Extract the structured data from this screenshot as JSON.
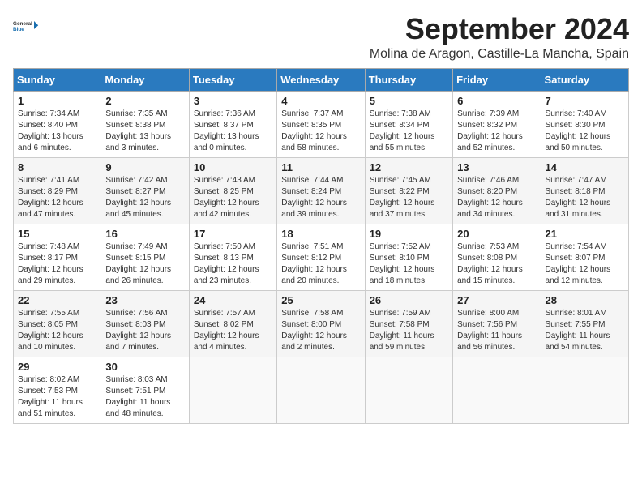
{
  "logo": {
    "text_general": "General",
    "text_blue": "Blue"
  },
  "title": "September 2024",
  "subtitle": "Molina de Aragon, Castille-La Mancha, Spain",
  "days_of_week": [
    "Sunday",
    "Monday",
    "Tuesday",
    "Wednesday",
    "Thursday",
    "Friday",
    "Saturday"
  ],
  "weeks": [
    [
      {
        "day": "1",
        "info": "Sunrise: 7:34 AM\nSunset: 8:40 PM\nDaylight: 13 hours\nand 6 minutes."
      },
      {
        "day": "2",
        "info": "Sunrise: 7:35 AM\nSunset: 8:38 PM\nDaylight: 13 hours\nand 3 minutes."
      },
      {
        "day": "3",
        "info": "Sunrise: 7:36 AM\nSunset: 8:37 PM\nDaylight: 13 hours\nand 0 minutes."
      },
      {
        "day": "4",
        "info": "Sunrise: 7:37 AM\nSunset: 8:35 PM\nDaylight: 12 hours\nand 58 minutes."
      },
      {
        "day": "5",
        "info": "Sunrise: 7:38 AM\nSunset: 8:34 PM\nDaylight: 12 hours\nand 55 minutes."
      },
      {
        "day": "6",
        "info": "Sunrise: 7:39 AM\nSunset: 8:32 PM\nDaylight: 12 hours\nand 52 minutes."
      },
      {
        "day": "7",
        "info": "Sunrise: 7:40 AM\nSunset: 8:30 PM\nDaylight: 12 hours\nand 50 minutes."
      }
    ],
    [
      {
        "day": "8",
        "info": "Sunrise: 7:41 AM\nSunset: 8:29 PM\nDaylight: 12 hours\nand 47 minutes."
      },
      {
        "day": "9",
        "info": "Sunrise: 7:42 AM\nSunset: 8:27 PM\nDaylight: 12 hours\nand 45 minutes."
      },
      {
        "day": "10",
        "info": "Sunrise: 7:43 AM\nSunset: 8:25 PM\nDaylight: 12 hours\nand 42 minutes."
      },
      {
        "day": "11",
        "info": "Sunrise: 7:44 AM\nSunset: 8:24 PM\nDaylight: 12 hours\nand 39 minutes."
      },
      {
        "day": "12",
        "info": "Sunrise: 7:45 AM\nSunset: 8:22 PM\nDaylight: 12 hours\nand 37 minutes."
      },
      {
        "day": "13",
        "info": "Sunrise: 7:46 AM\nSunset: 8:20 PM\nDaylight: 12 hours\nand 34 minutes."
      },
      {
        "day": "14",
        "info": "Sunrise: 7:47 AM\nSunset: 8:18 PM\nDaylight: 12 hours\nand 31 minutes."
      }
    ],
    [
      {
        "day": "15",
        "info": "Sunrise: 7:48 AM\nSunset: 8:17 PM\nDaylight: 12 hours\nand 29 minutes."
      },
      {
        "day": "16",
        "info": "Sunrise: 7:49 AM\nSunset: 8:15 PM\nDaylight: 12 hours\nand 26 minutes."
      },
      {
        "day": "17",
        "info": "Sunrise: 7:50 AM\nSunset: 8:13 PM\nDaylight: 12 hours\nand 23 minutes."
      },
      {
        "day": "18",
        "info": "Sunrise: 7:51 AM\nSunset: 8:12 PM\nDaylight: 12 hours\nand 20 minutes."
      },
      {
        "day": "19",
        "info": "Sunrise: 7:52 AM\nSunset: 8:10 PM\nDaylight: 12 hours\nand 18 minutes."
      },
      {
        "day": "20",
        "info": "Sunrise: 7:53 AM\nSunset: 8:08 PM\nDaylight: 12 hours\nand 15 minutes."
      },
      {
        "day": "21",
        "info": "Sunrise: 7:54 AM\nSunset: 8:07 PM\nDaylight: 12 hours\nand 12 minutes."
      }
    ],
    [
      {
        "day": "22",
        "info": "Sunrise: 7:55 AM\nSunset: 8:05 PM\nDaylight: 12 hours\nand 10 minutes."
      },
      {
        "day": "23",
        "info": "Sunrise: 7:56 AM\nSunset: 8:03 PM\nDaylight: 12 hours\nand 7 minutes."
      },
      {
        "day": "24",
        "info": "Sunrise: 7:57 AM\nSunset: 8:02 PM\nDaylight: 12 hours\nand 4 minutes."
      },
      {
        "day": "25",
        "info": "Sunrise: 7:58 AM\nSunset: 8:00 PM\nDaylight: 12 hours\nand 2 minutes."
      },
      {
        "day": "26",
        "info": "Sunrise: 7:59 AM\nSunset: 7:58 PM\nDaylight: 11 hours\nand 59 minutes."
      },
      {
        "day": "27",
        "info": "Sunrise: 8:00 AM\nSunset: 7:56 PM\nDaylight: 11 hours\nand 56 minutes."
      },
      {
        "day": "28",
        "info": "Sunrise: 8:01 AM\nSunset: 7:55 PM\nDaylight: 11 hours\nand 54 minutes."
      }
    ],
    [
      {
        "day": "29",
        "info": "Sunrise: 8:02 AM\nSunset: 7:53 PM\nDaylight: 11 hours\nand 51 minutes."
      },
      {
        "day": "30",
        "info": "Sunrise: 8:03 AM\nSunset: 7:51 PM\nDaylight: 11 hours\nand 48 minutes."
      },
      {
        "day": "",
        "info": ""
      },
      {
        "day": "",
        "info": ""
      },
      {
        "day": "",
        "info": ""
      },
      {
        "day": "",
        "info": ""
      },
      {
        "day": "",
        "info": ""
      }
    ]
  ]
}
